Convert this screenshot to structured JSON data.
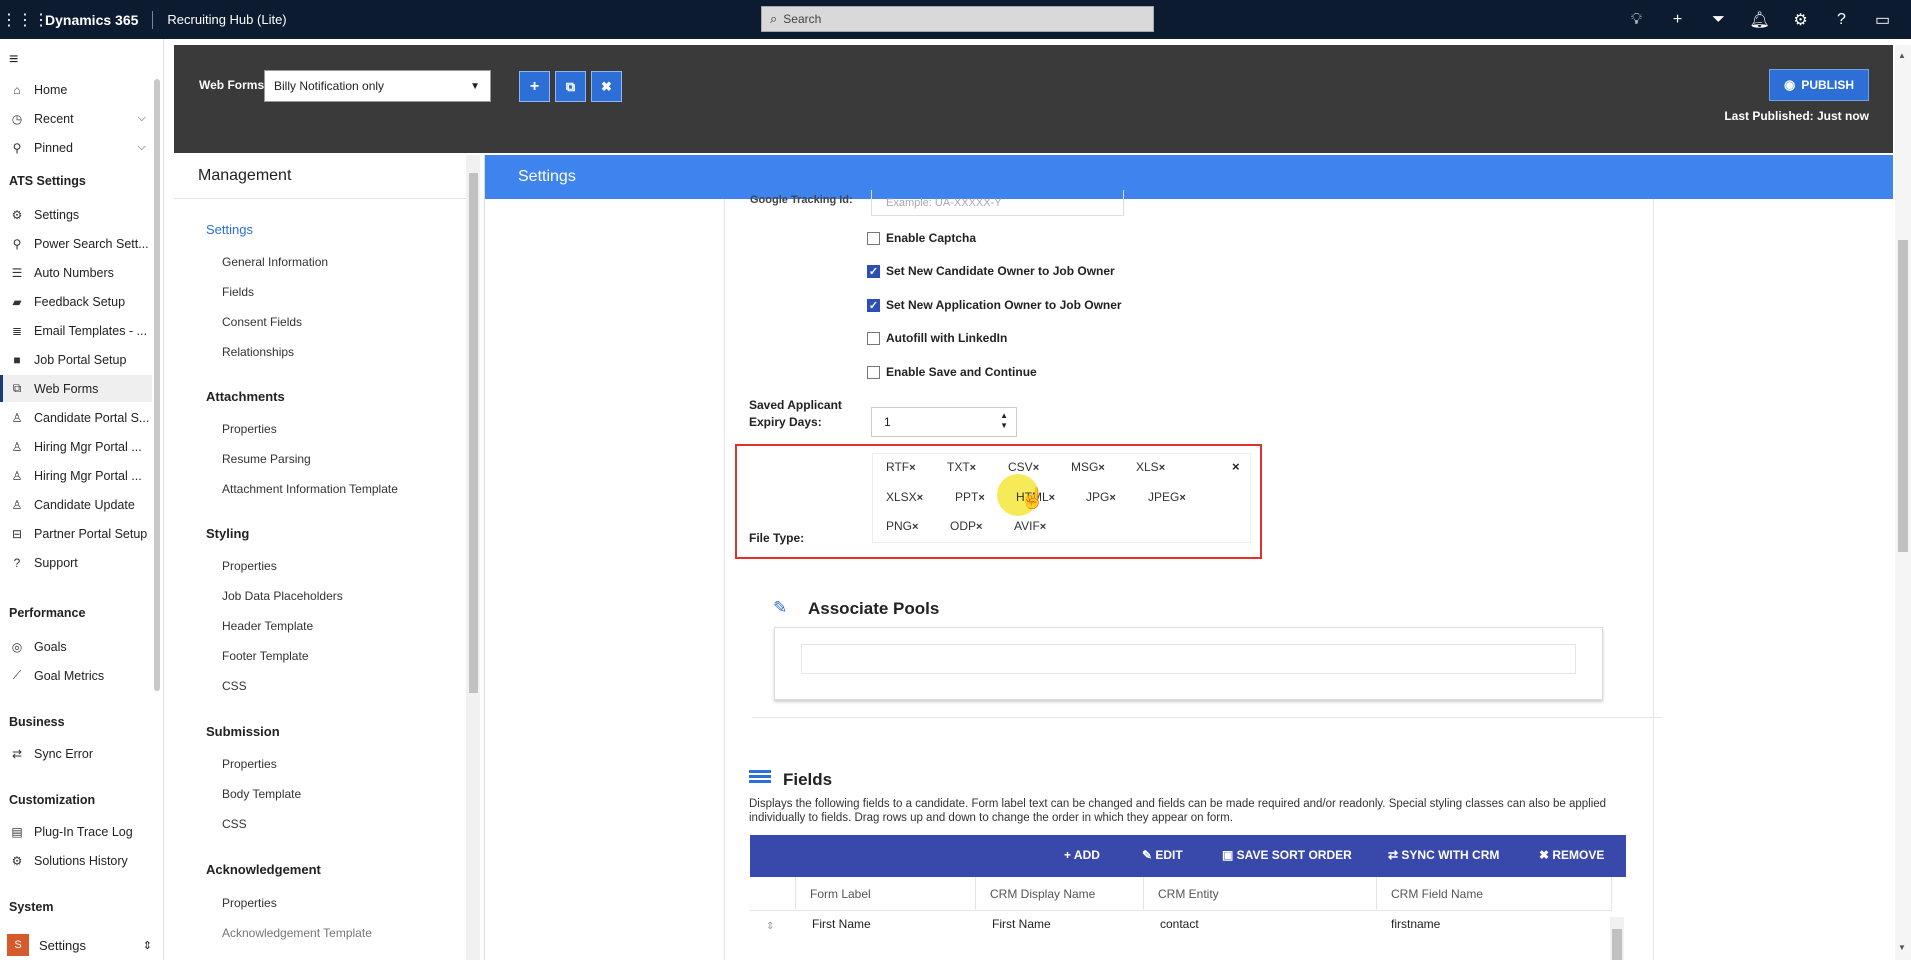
{
  "topbar": {
    "brand": "Dynamics 365",
    "app_name": "Recruiting Hub (Lite)",
    "search_placeholder": "Search",
    "icons": [
      "lightbulb-icon",
      "plus-icon",
      "filter-icon",
      "bell-icon",
      "gear-icon",
      "help-icon",
      "chat-icon"
    ]
  },
  "nav": {
    "items": [
      {
        "label": "Home",
        "icon": "home-icon"
      },
      {
        "label": "Recent",
        "icon": "clock-icon"
      },
      {
        "label": "Pinned",
        "icon": "pin-icon"
      },
      {
        "label": "Settings",
        "icon": "gear-icon"
      },
      {
        "label": "Power Search Sett...",
        "icon": "search-settings-icon"
      },
      {
        "label": "Auto Numbers",
        "icon": "list-number-icon"
      },
      {
        "label": "Feedback Setup",
        "icon": "feedback-icon"
      },
      {
        "label": "Email Templates - ...",
        "icon": "email-template-icon"
      },
      {
        "label": "Job Portal Setup",
        "icon": "briefcase-icon"
      },
      {
        "label": "Web Forms",
        "icon": "web-form-icon"
      },
      {
        "label": "Candidate Portal S...",
        "icon": "candidate-portal-icon"
      },
      {
        "label": "Hiring Mgr Portal ...",
        "icon": "hiring-portal-icon"
      },
      {
        "label": "Hiring Mgr Portal ...",
        "icon": "hiring-portal-icon"
      },
      {
        "label": "Candidate Update",
        "icon": "person-update-icon"
      },
      {
        "label": "Partner Portal Setup",
        "icon": "partner-portal-icon"
      },
      {
        "label": "Support",
        "icon": "help-icon"
      },
      {
        "label": "Goals",
        "icon": "target-icon"
      },
      {
        "label": "Goal Metrics",
        "icon": "chart-icon"
      },
      {
        "label": "Sync Error",
        "icon": "sync-icon"
      },
      {
        "label": "Plug-In Trace Log",
        "icon": "log-icon"
      },
      {
        "label": "Solutions History",
        "icon": "history-icon"
      }
    ],
    "groups": [
      "ATS Settings",
      "Performance",
      "Business",
      "Customization",
      "System"
    ],
    "area": {
      "badge": "S",
      "label": "Settings"
    }
  },
  "header": {
    "web_form_label": "Web Forms",
    "selected_form": "Billy Notification only",
    "publish_label": "PUBLISH",
    "last_published": "Last Published: Just now"
  },
  "management": {
    "title": "Management",
    "sections": [
      {
        "title": "Settings",
        "items": [
          "General Information",
          "Fields",
          "Consent Fields",
          "Relationships"
        ]
      },
      {
        "title": "Attachments",
        "items": [
          "Properties",
          "Resume Parsing",
          "Attachment Information Template"
        ]
      },
      {
        "title": "Styling",
        "items": [
          "Properties",
          "Job Data Placeholders",
          "Header Template",
          "Footer Template",
          "CSS"
        ]
      },
      {
        "title": "Submission",
        "items": [
          "Properties",
          "Body Template",
          "CSS"
        ]
      },
      {
        "title": "Acknowledgement",
        "items": [
          "Properties",
          "Acknowledgement Template"
        ]
      }
    ]
  },
  "settings": {
    "title": "Settings",
    "google_tracking_label": "Google Tracking Id:",
    "google_tracking_placeholder": "Example: UA-XXXXX-Y",
    "checkboxes": [
      {
        "label": "Enable Captcha",
        "checked": false
      },
      {
        "label": "Set New Candidate Owner to Job Owner",
        "checked": true
      },
      {
        "label": "Set New Application Owner to Job Owner",
        "checked": true
      },
      {
        "label": "Autofill with LinkedIn",
        "checked": false
      },
      {
        "label": "Enable Save and Continue",
        "checked": false
      }
    ],
    "expiry_label_1": "Saved Applicant",
    "expiry_label_2": "Expiry Days:",
    "expiry_value": "1",
    "file_type_label": "File Type:",
    "file_types": [
      "RTF",
      "TXT",
      "CSV",
      "MSG",
      "XLS",
      "XLSX",
      "PPT",
      "HTML",
      "JPG",
      "JPEG",
      "PNG",
      "ODP",
      "AVIF"
    ],
    "remove_glyph": "×"
  },
  "pools": {
    "title": "Associate Pools"
  },
  "fields": {
    "title": "Fields",
    "description": "Displays the following fields to a candidate. Form label text can be changed and fields can be made required and/or readonly. Special styling classes can also be applied individually to fields. Drag rows up and down to change the order in which they appear on form.",
    "toolbar": {
      "add": "ADD",
      "edit": "EDIT",
      "save_sort": "SAVE SORT ORDER",
      "sync": "SYNC WITH CRM",
      "remove": "REMOVE"
    },
    "columns": [
      "Form Label",
      "CRM Display Name",
      "CRM Entity",
      "CRM Field Name"
    ],
    "rows": [
      [
        "First Name",
        "First Name",
        "contact",
        "firstname"
      ]
    ]
  },
  "colors": {
    "topbar": "#0d1b30",
    "accent": "#3f83ef",
    "toolbar": "#3949ab",
    "highlight": "#e0312b"
  }
}
